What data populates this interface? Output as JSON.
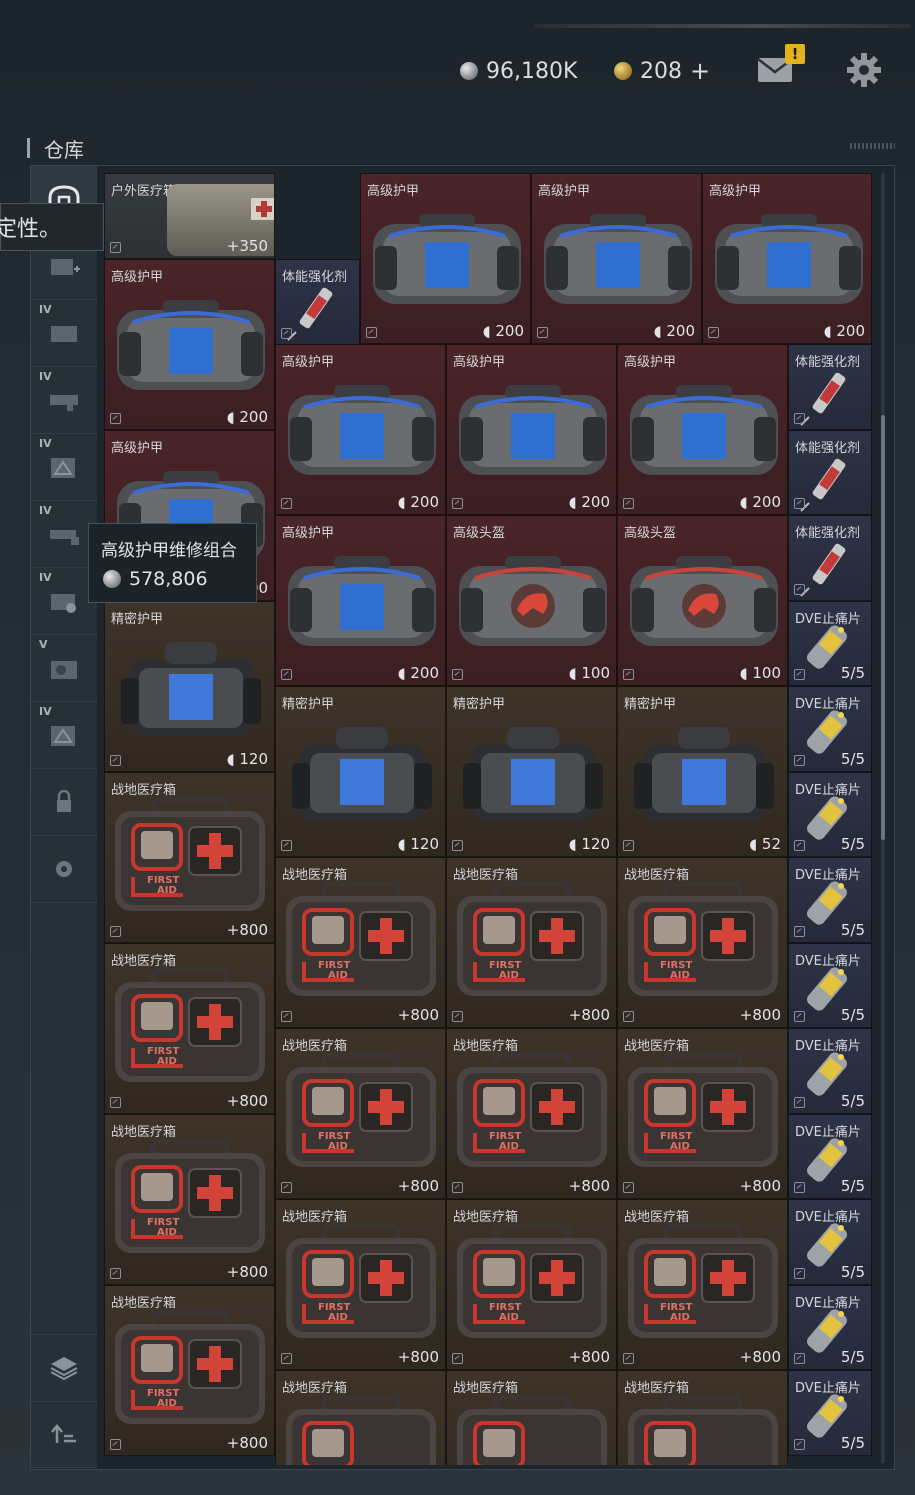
{
  "header": {
    "silver_amount": "96,180K",
    "gold_amount": "208",
    "gold_add": "+",
    "mail_badge": "!"
  },
  "warehouse": {
    "title": "仓库",
    "tooltip_left": "定性。",
    "sidebar": [
      {
        "name": "sidebar-item-chest",
        "label": ""
      },
      {
        "name": "sidebar-item-tab1",
        "label": "IV"
      },
      {
        "name": "sidebar-item-tab2",
        "label": "IV"
      },
      {
        "name": "sidebar-item-tab3",
        "label": "IV"
      },
      {
        "name": "sidebar-item-tab4",
        "label": "IV"
      },
      {
        "name": "sidebar-item-tab5",
        "label": "IV"
      },
      {
        "name": "sidebar-item-tab6",
        "label": "IV"
      },
      {
        "name": "sidebar-item-tab7",
        "label": "V"
      },
      {
        "name": "sidebar-item-tab8",
        "label": "IV"
      }
    ]
  },
  "hover_tooltip": {
    "title": "高级护甲维修组合",
    "price": "578,806"
  },
  "items": {
    "c0": {
      "name": "户外医疗箱",
      "qty": "+350"
    },
    "c1": {
      "name": "高级护甲",
      "qty": "200"
    },
    "c2": {
      "name": "高级护甲",
      "qty": "200"
    },
    "c3": {
      "name": "高级护甲",
      "qty": "200"
    },
    "c4": {
      "name": "高级护甲",
      "qty": "200"
    },
    "c5": {
      "name": "体能强化剂",
      "qty": ""
    },
    "c6": {
      "name": "高级护甲",
      "qty": "200"
    },
    "c7": {
      "name": "高级护甲",
      "qty": "200"
    },
    "c8": {
      "name": "高级护甲",
      "qty": "200"
    },
    "c9": {
      "name": "体能强化剂",
      "qty": ""
    },
    "c10": {
      "name": "高级护甲",
      "qty": "200"
    },
    "c11": {
      "name": "体能强化剂",
      "qty": ""
    },
    "c12": {
      "name": "高级护甲",
      "qty": "200"
    },
    "c13": {
      "name": "高级头盔",
      "qty": "100"
    },
    "c14": {
      "name": "高级头盔",
      "qty": "100"
    },
    "c15": {
      "name": "体能强化剂",
      "qty": ""
    },
    "c16": {
      "name": "精密护甲",
      "qty": "120"
    },
    "c17": {
      "name": "DVE止痛片",
      "qty": "5/5"
    },
    "c18": {
      "name": "精密护甲",
      "qty": "120"
    },
    "c19": {
      "name": "精密护甲",
      "qty": "120"
    },
    "c20": {
      "name": "精密护甲",
      "qty": "52"
    },
    "c21": {
      "name": "DVE止痛片",
      "qty": "5/5"
    },
    "c22": {
      "name": "战地医疗箱",
      "qty": "+800"
    },
    "c23": {
      "name": "DVE止痛片",
      "qty": "5/5"
    },
    "c24": {
      "name": "战地医疗箱",
      "qty": "+800"
    },
    "c25": {
      "name": "战地医疗箱",
      "qty": "+800"
    },
    "c26": {
      "name": "战地医疗箱",
      "qty": "+800"
    },
    "c27": {
      "name": "DVE止痛片",
      "qty": "5/5"
    },
    "c28": {
      "name": "战地医疗箱",
      "qty": "+800"
    },
    "c29": {
      "name": "DVE止痛片",
      "qty": "5/5"
    },
    "c30": {
      "name": "战地医疗箱",
      "qty": "+800"
    },
    "c31": {
      "name": "战地医疗箱",
      "qty": "+800"
    },
    "c32": {
      "name": "战地医疗箱",
      "qty": "+800"
    },
    "c33": {
      "name": "DVE止痛片",
      "qty": "5/5"
    },
    "c34": {
      "name": "战地医疗箱",
      "qty": "+800"
    },
    "c35": {
      "name": "DVE止痛片",
      "qty": "5/5"
    },
    "c36": {
      "name": "战地医疗箱",
      "qty": "+800"
    },
    "c37": {
      "name": "战地医疗箱",
      "qty": "+800"
    },
    "c38": {
      "name": "战地医疗箱",
      "qty": "+800"
    },
    "c39": {
      "name": "DVE止痛片",
      "qty": "5/5"
    },
    "c40": {
      "name": "战地医疗箱",
      "qty": "+800"
    },
    "c41": {
      "name": "DVE止痛片",
      "qty": "5/5"
    },
    "c42": {
      "name": "战地医疗箱",
      "qty": ""
    },
    "c43": {
      "name": "战地医疗箱",
      "qty": ""
    },
    "c44": {
      "name": "战地医疗箱",
      "qty": ""
    },
    "c45": {
      "name": "DVE止痛片",
      "qty": "5/5"
    }
  }
}
